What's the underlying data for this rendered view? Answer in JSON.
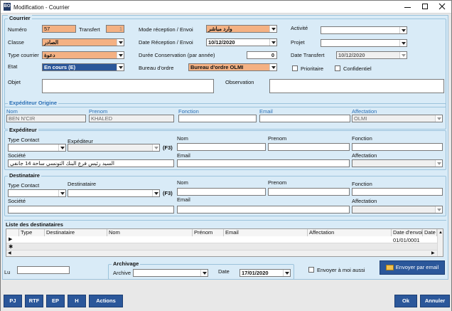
{
  "window": {
    "title": "Modification - Courrier"
  },
  "courrier": {
    "group_title": "Courrier",
    "numero_label": "Numéro",
    "numero_value": "57",
    "transfert_label": "Transfert",
    "transfert_value": "1",
    "classe_label": "Classe",
    "classe_value": "الصادر",
    "type_label": "Type courrier",
    "type_value": "دعوة",
    "etat_label": "Etat",
    "etat_value": "En cours (E)",
    "mode_label": "Mode réception / Envoi",
    "mode_value": "وارد مباشر",
    "date_label": "Date Réception / Envoi",
    "date_value": "10/12/2020",
    "duree_label": "Durée Conservation (par année)",
    "duree_value": "0",
    "bureau_label": "Bureau d'ordre",
    "bureau_value": "Bureau d'ordre OLMI",
    "activite_label": "Activité",
    "activite_value": "",
    "projet_label": "Projet",
    "projet_value": "",
    "date_transfert_label": "Date Transfert",
    "date_transfert_value": "10/12/2020",
    "prioritaire_label": "Prioritaire",
    "confidentiel_label": "Confidentiel",
    "objet_label": "Objet",
    "objet_value": "",
    "observation_label": "Observation",
    "observation_value": ""
  },
  "exp_origine": {
    "group_title": "Expéditeur Origine",
    "nom_label": "Nom",
    "nom_value": "BEN N'CIR",
    "prenom_label": "Prenom",
    "prenom_value": "KHALED",
    "fonction_label": "Fonction",
    "fonction_value": "",
    "email_label": "Email",
    "email_value": "",
    "affectation_label": "Affectation",
    "affectation_value": "OLMI"
  },
  "expediteur": {
    "group_title": "Expéditeur",
    "type_contact_label": "Type Contact",
    "type_contact_value": "",
    "expediteur_label": "Expéditeur",
    "expediteur_value": "",
    "f3": "(F3)",
    "nom_label": "Nom",
    "nom_value": "",
    "prenom_label": "Prenom",
    "prenom_value": "",
    "fonction_label": "Fonction",
    "fonction_value": "",
    "societe_label": "Société",
    "societe_value": "السيد رئيس فرع البنك التونسي ساحة 14 جانفي",
    "email_label": "Email",
    "email_value": "",
    "affectation_label": "Affectation",
    "affectation_value": ""
  },
  "destinataire": {
    "group_title": "Destinataire",
    "type_contact_label": "Type Contact",
    "type_contact_value": "",
    "destinataire_label": "Destinataire",
    "destinataire_value": "",
    "f3": "(F3)",
    "nom_label": "Nom",
    "nom_value": "",
    "prenom_label": "Prenom",
    "prenom_value": "",
    "fonction_label": "Fonction",
    "fonction_value": "",
    "societe_label": "Société",
    "societe_value": "",
    "email_label": "Email",
    "email_value": "",
    "affectation_label": "Affectation",
    "affectation_value": ""
  },
  "liste": {
    "title": "Liste des destinataires",
    "columns": [
      "Type",
      "Destinataire",
      "Nom",
      "Prénom",
      "Email",
      "Affectation",
      "Date d'envoi",
      "Date L"
    ],
    "row_date": "01/01/0001"
  },
  "archivage": {
    "title": "Archivage",
    "archive_label": "Archive",
    "archive_value": "",
    "date_label": "Date",
    "date_value": "17/01/2020"
  },
  "lu_label": "Lu",
  "lu_value": "",
  "envoyer_moi_label": "Envoyer à moi aussi",
  "envoyer_email_label": "Envoyer par email",
  "buttons": {
    "pj": "PJ",
    "rtf": "RTF",
    "ep": "EP",
    "h": "H",
    "actions": "Actions",
    "ok": "Ok",
    "annuler": "Annuler"
  },
  "colors": {
    "accent": "#2b579a",
    "orange_field": "#f4b183",
    "panel": "#d9ebf7",
    "label_blue": "#2a6fb5"
  }
}
